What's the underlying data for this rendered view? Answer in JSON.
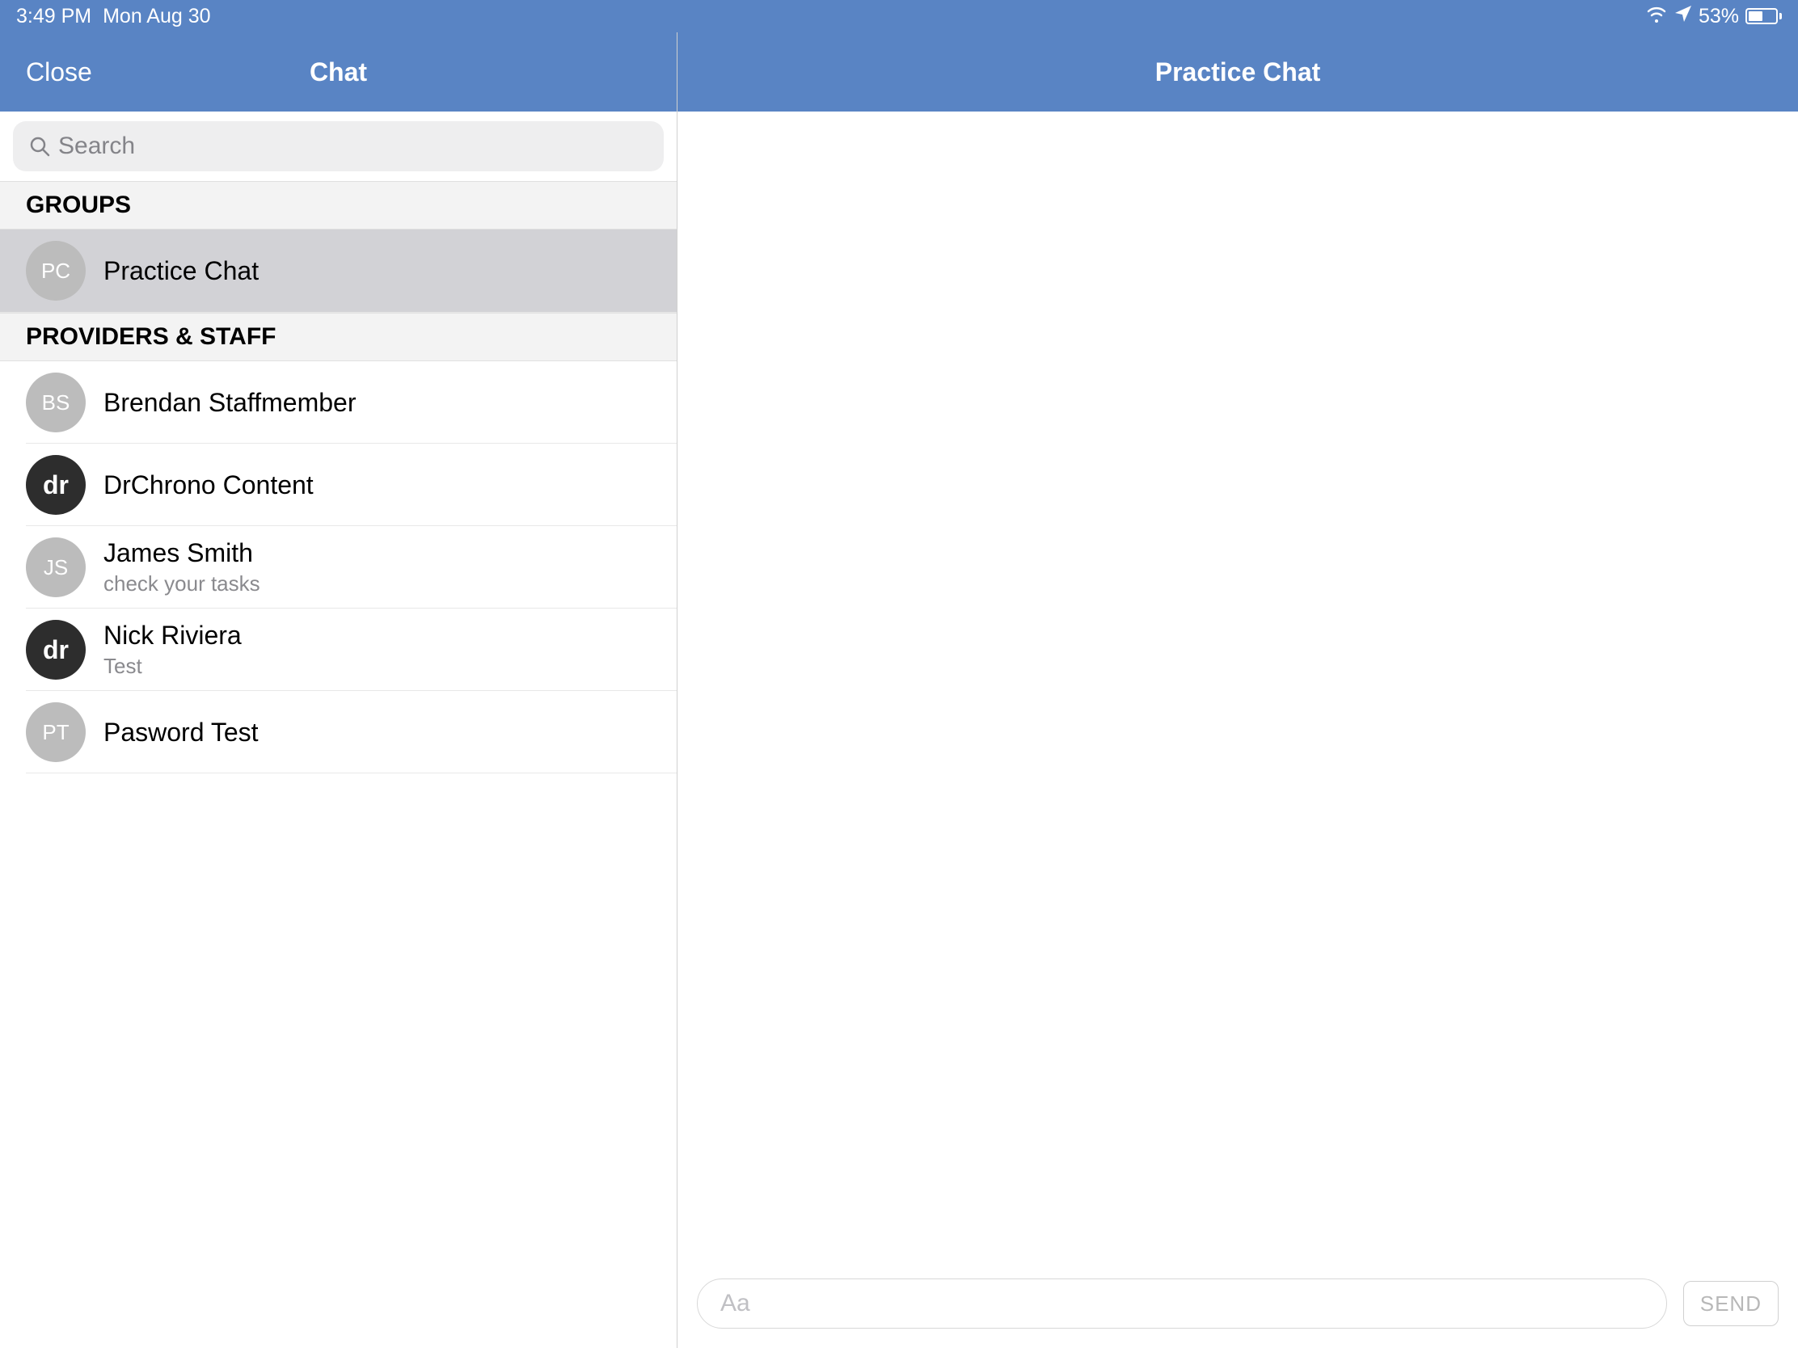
{
  "status_bar": {
    "time": "3:49 PM",
    "date": "Mon Aug 30",
    "battery_percent": "53%"
  },
  "left_panel": {
    "close_label": "Close",
    "title": "Chat",
    "search_placeholder": "Search"
  },
  "sections": {
    "groups_label": "GROUPS",
    "providers_label": "PROVIDERS & STAFF"
  },
  "groups": [
    {
      "initials": "PC",
      "name": "Practice Chat",
      "avatar_style": "gray",
      "selected": true
    }
  ],
  "providers": [
    {
      "initials": "BS",
      "name": "Brendan Staffmember",
      "subtitle": "",
      "avatar_style": "gray"
    },
    {
      "initials": "dr",
      "name": "DrChrono Content",
      "subtitle": "",
      "avatar_style": "dark"
    },
    {
      "initials": "JS",
      "name": "James Smith",
      "subtitle": "check your tasks",
      "avatar_style": "gray"
    },
    {
      "initials": "dr",
      "name": "Nick Riviera",
      "subtitle": "Test",
      "avatar_style": "dark"
    },
    {
      "initials": "PT",
      "name": "Pasword Test",
      "subtitle": "",
      "avatar_style": "gray"
    }
  ],
  "right_panel": {
    "title": "Practice Chat",
    "message_placeholder": "Aa",
    "send_label": "SEND"
  }
}
